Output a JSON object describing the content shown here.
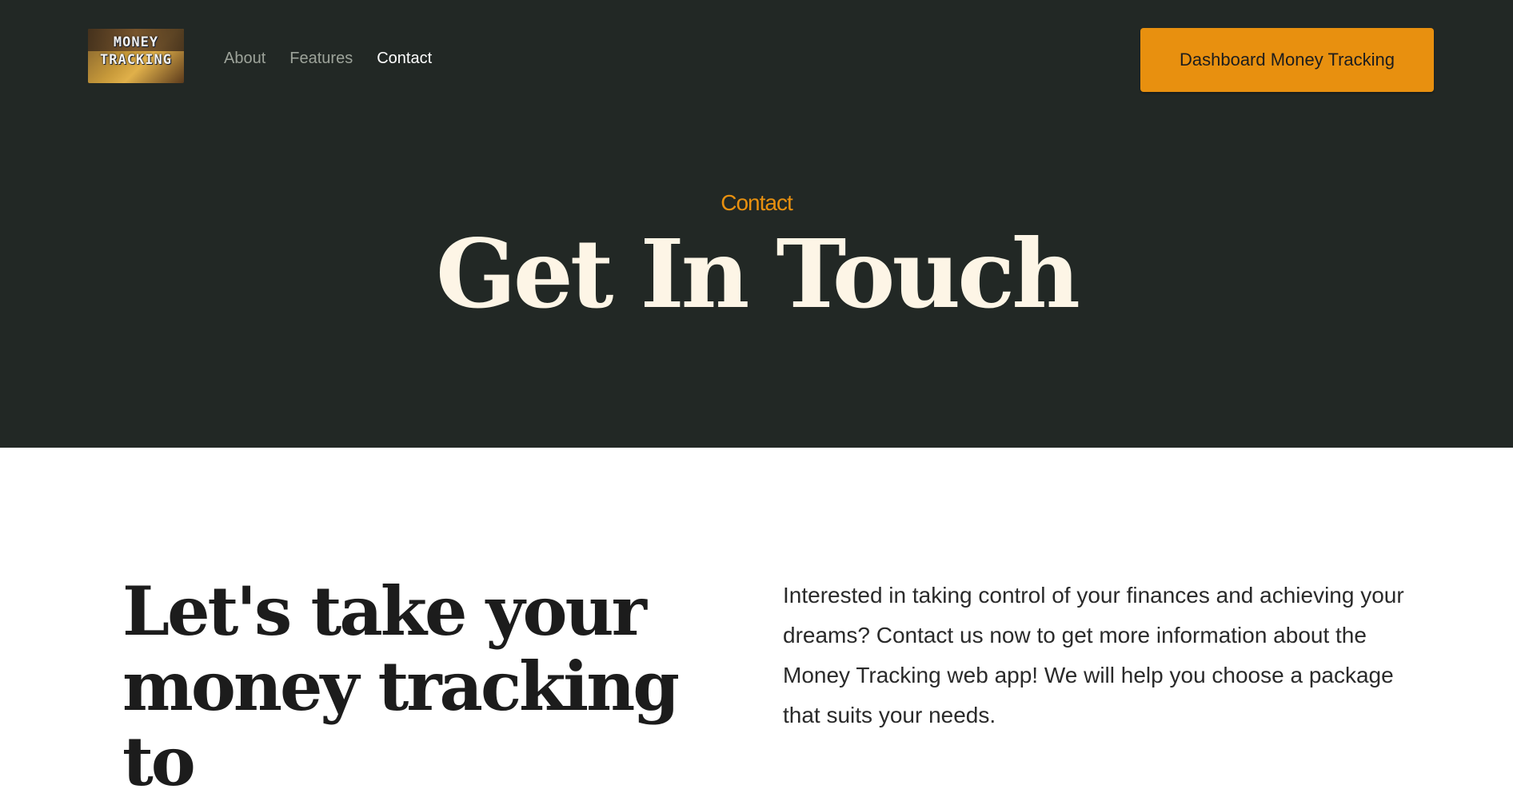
{
  "header": {
    "logo_text": "MONEY\nTRACKING",
    "nav": [
      {
        "label": "About",
        "active": false
      },
      {
        "label": "Features",
        "active": false
      },
      {
        "label": "Contact",
        "active": true
      }
    ],
    "cta_label": "Dashboard Money Tracking"
  },
  "hero": {
    "eyebrow": "Contact",
    "title": "Get In Touch"
  },
  "content": {
    "heading": "Let's take your money tracking to",
    "body": "Interested in taking control of your finances and achieving your dreams? Contact us now to get more information about the Money Tracking web app! We will help you choose a package that suits your needs."
  },
  "colors": {
    "hero_bg": "#222825",
    "accent": "#e8900f",
    "hero_title": "#fdf5e6",
    "nav_inactive": "#9da39a",
    "nav_active": "#ffffff"
  }
}
